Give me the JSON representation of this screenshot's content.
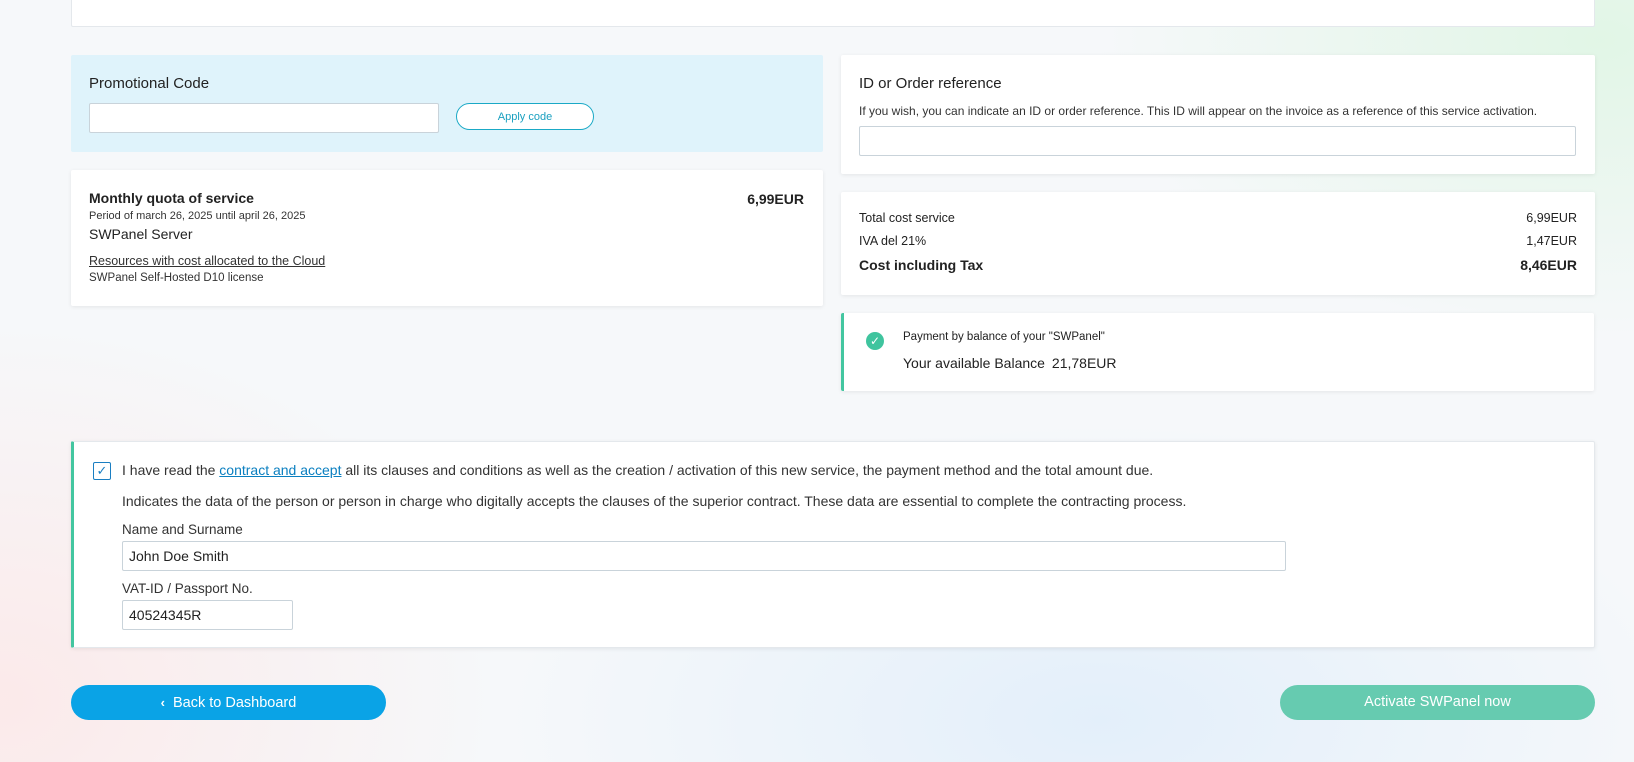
{
  "promo": {
    "title": "Promotional Code",
    "input_value": "",
    "apply_label": "Apply code"
  },
  "quota": {
    "title": "Monthly quota of service",
    "price": "6,99EUR",
    "period": "Period of march 26, 2025 until april 26, 2025",
    "product": "SWPanel Server",
    "resources_link": "Resources with cost allocated to the Cloud",
    "license": "SWPanel Self-Hosted D10 license"
  },
  "idref": {
    "title": "ID or Order reference",
    "description": "If you wish, you can indicate an ID or order reference. This ID will appear on the invoice as a reference of this service activation.",
    "input_value": ""
  },
  "totals": {
    "rows": [
      {
        "label": "Total cost service",
        "value": "6,99EUR"
      },
      {
        "label": "IVA del 21%",
        "value": "1,47EUR"
      },
      {
        "label": "Cost including Tax",
        "value": "8,46EUR"
      }
    ]
  },
  "payment": {
    "method": "Payment by balance of your \"SWPanel\"",
    "balance_label": "Your available Balance",
    "balance_value": "21,78EUR"
  },
  "contract": {
    "checked": true,
    "accept_prefix": "I have read the ",
    "accept_link": "contract and accept",
    "accept_suffix": " all its clauses and conditions as well as the creation / activation of this new service, the payment method and the total amount due.",
    "indication": "Indicates the data of the person or person in charge who digitally accepts the clauses of the superior contract. These data are essential to complete the contracting process.",
    "name_label": "Name and Surname",
    "name_value": "John Doe Smith",
    "vat_label": "VAT-ID / Passport No.",
    "vat_value": "40524345R"
  },
  "actions": {
    "back_label": "Back to Dashboard",
    "activate_label": "Activate SWPanel now"
  },
  "colors": {
    "primary": "#0aa3e6",
    "accent_green": "#43c6a0",
    "activate_bg": "#66cbb0",
    "promo_bg": "#dff3fb"
  }
}
